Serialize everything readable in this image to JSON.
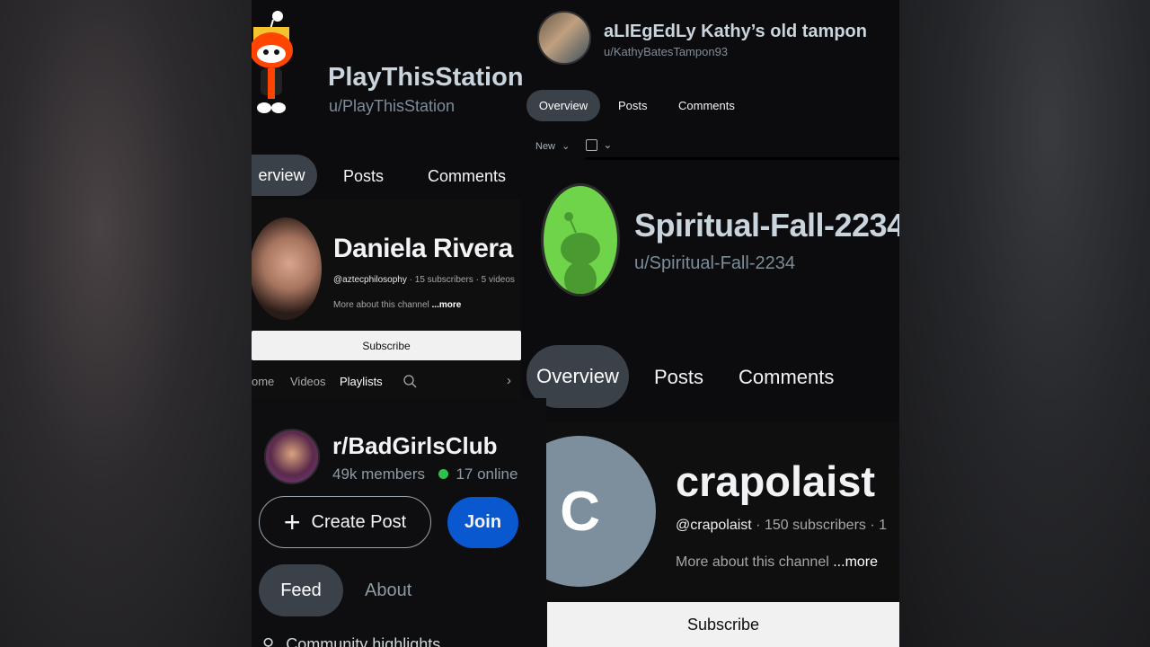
{
  "panel1": {
    "display_name": "PlayThisStation",
    "username": "u/PlayThisStation",
    "tabs": [
      "erview",
      "Posts",
      "Comments"
    ]
  },
  "panel2": {
    "display_name": "aLIEgEdLy Kathy’s old tampon",
    "username": "u/KathyBatesTampon93",
    "tabs": [
      "Overview",
      "Posts",
      "Comments"
    ],
    "sort_label": "New"
  },
  "panel3": {
    "name": "Daniela Rivera",
    "handle": "@aztecphilosophy",
    "meta": "· 15 subscribers · 5 videos",
    "more_text": "More about this channel",
    "more_link": "...more",
    "subscribe": "Subscribe",
    "tabs": [
      "ome",
      "Videos",
      "Playlists"
    ]
  },
  "panel4": {
    "display_name": "Spiritual-Fall-2234",
    "username": "u/Spiritual-Fall-2234",
    "tabs": [
      "Overview",
      "Posts",
      "Comments"
    ]
  },
  "panel5": {
    "name": "r/BadGirlsClub",
    "members": "49k members",
    "online": "17 online",
    "create_post": "Create Post",
    "join": "Join",
    "tabs": [
      "Feed",
      "About"
    ],
    "highlights": "Community highlights"
  },
  "panel6": {
    "avatar_letter": "C",
    "name": "crapolaist",
    "handle": "@crapolaist",
    "meta": "· 150 subscribers · 1",
    "more_text": "More about this channel",
    "more_link": "...more",
    "subscribe": "Subscribe"
  },
  "colors": {
    "join_blue": "#0a58d0",
    "online_green": "#2ec24b",
    "pill_bg": "#3a4148",
    "avatar_green": "#6fd44a",
    "avatar_gray": "#7d8f9d"
  }
}
